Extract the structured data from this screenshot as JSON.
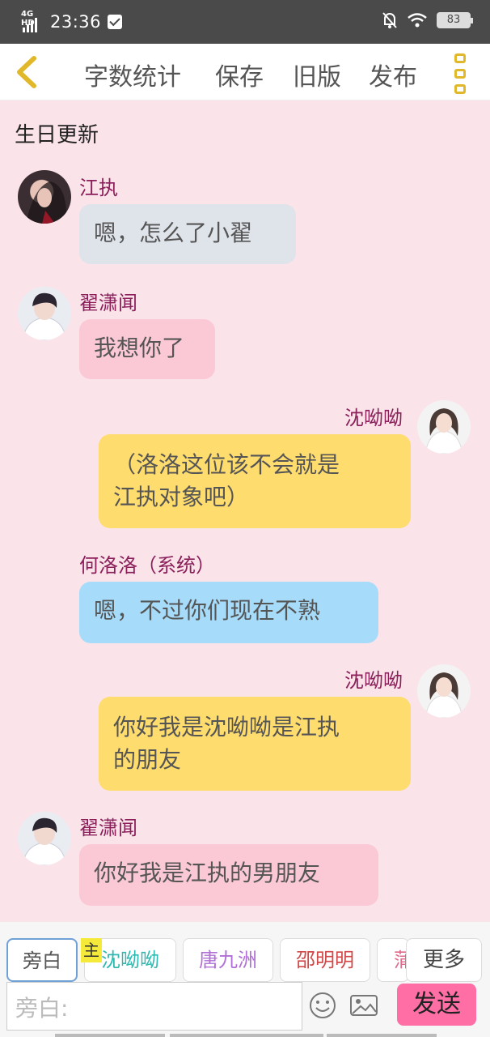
{
  "status_bar": {
    "network": "4G HD",
    "time": "23:36",
    "battery": "83"
  },
  "nav": {
    "items": [
      "字数统计",
      "保存",
      "旧版",
      "发布"
    ]
  },
  "chapter_title": "生日更新",
  "messages": [
    {
      "name": "江执",
      "text": "嗯，怎么了小翟"
    },
    {
      "name": "翟潇闻",
      "text": "我想你了"
    },
    {
      "name": "沈呦呦",
      "text_line1": "（洛洛这位该不会就是",
      "text_line2": "江执对象吧）"
    },
    {
      "name": "何洛洛（系统）",
      "text": "嗯，不过你们现在不熟"
    },
    {
      "name": "沈呦呦",
      "text_line1": "你好我是沈呦呦是江执",
      "text_line2": "的朋友"
    },
    {
      "name": "翟潇闻",
      "text": "你好我是江执的男朋友"
    }
  ],
  "bottom": {
    "roles": [
      "旁白",
      "沈呦呦",
      "唐九洲",
      "邵明明",
      "蒲"
    ],
    "host_tag": "主",
    "more_label": "更多",
    "input_placeholder": "旁白:",
    "send_label": "发送"
  },
  "colors": {
    "accent_gold": "#e0b82a",
    "name_color": "#8a1f5a",
    "send_pink": "#ff6ea5",
    "role_colors": [
      "#555555",
      "#2fb8b0",
      "#b070d6",
      "#d04848",
      "#e06a8a"
    ]
  }
}
